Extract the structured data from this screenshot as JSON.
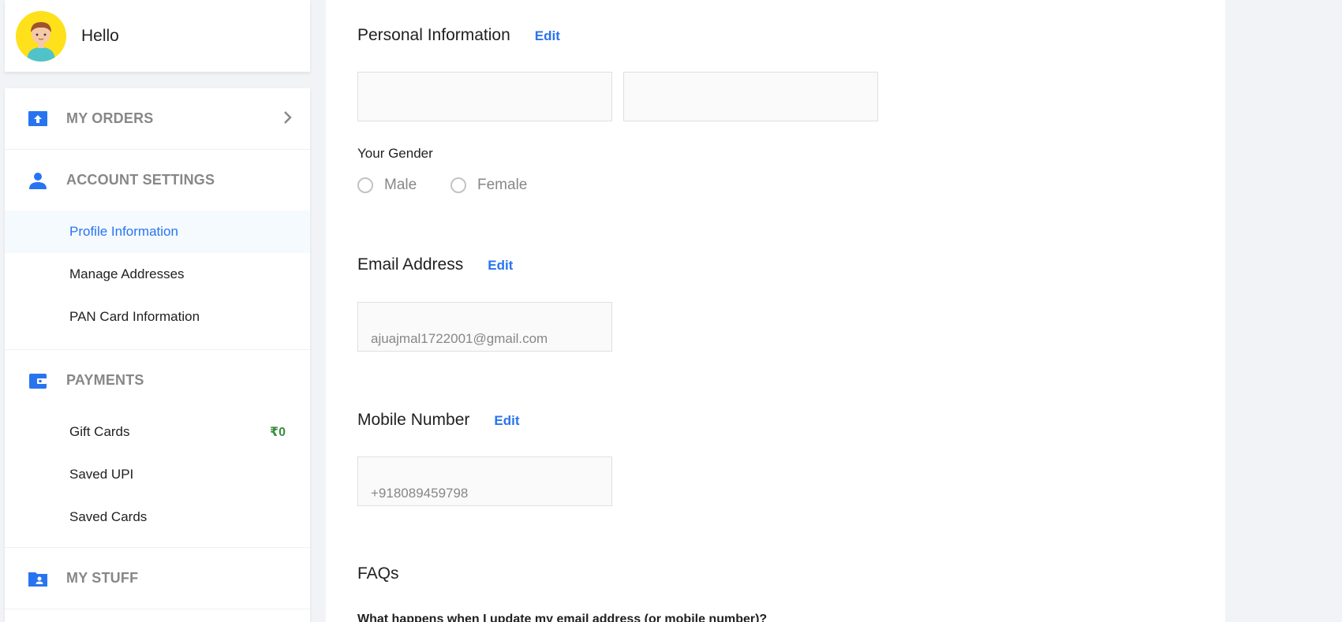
{
  "profile": {
    "greeting": "Hello"
  },
  "sidebar": {
    "orders": {
      "label": "MY ORDERS"
    },
    "account": {
      "label": "ACCOUNT SETTINGS",
      "items": [
        {
          "label": "Profile Information"
        },
        {
          "label": "Manage Addresses"
        },
        {
          "label": "PAN Card Information"
        }
      ]
    },
    "payments": {
      "label": "PAYMENTS",
      "items": [
        {
          "label": "Gift Cards",
          "amount": "₹0"
        },
        {
          "label": "Saved UPI"
        },
        {
          "label": "Saved Cards"
        }
      ]
    },
    "stuff": {
      "label": "MY STUFF"
    }
  },
  "personal": {
    "title": "Personal Information",
    "edit": "Edit",
    "first_name": "",
    "last_name": "",
    "gender_label": "Your Gender",
    "gender_options": [
      "Male",
      "Female"
    ]
  },
  "email": {
    "title": "Email Address",
    "edit": "Edit",
    "value": "ajuajmal1722001@gmail.com"
  },
  "mobile": {
    "title": "Mobile Number",
    "edit": "Edit",
    "value": "+918089459798"
  },
  "faq": {
    "title": "FAQs",
    "question": "What happens when I update my email address (or mobile number)?"
  },
  "colors": {
    "accent": "#2874f0",
    "amount": "#388e3c",
    "avatar_bg": "#ffe11b"
  }
}
